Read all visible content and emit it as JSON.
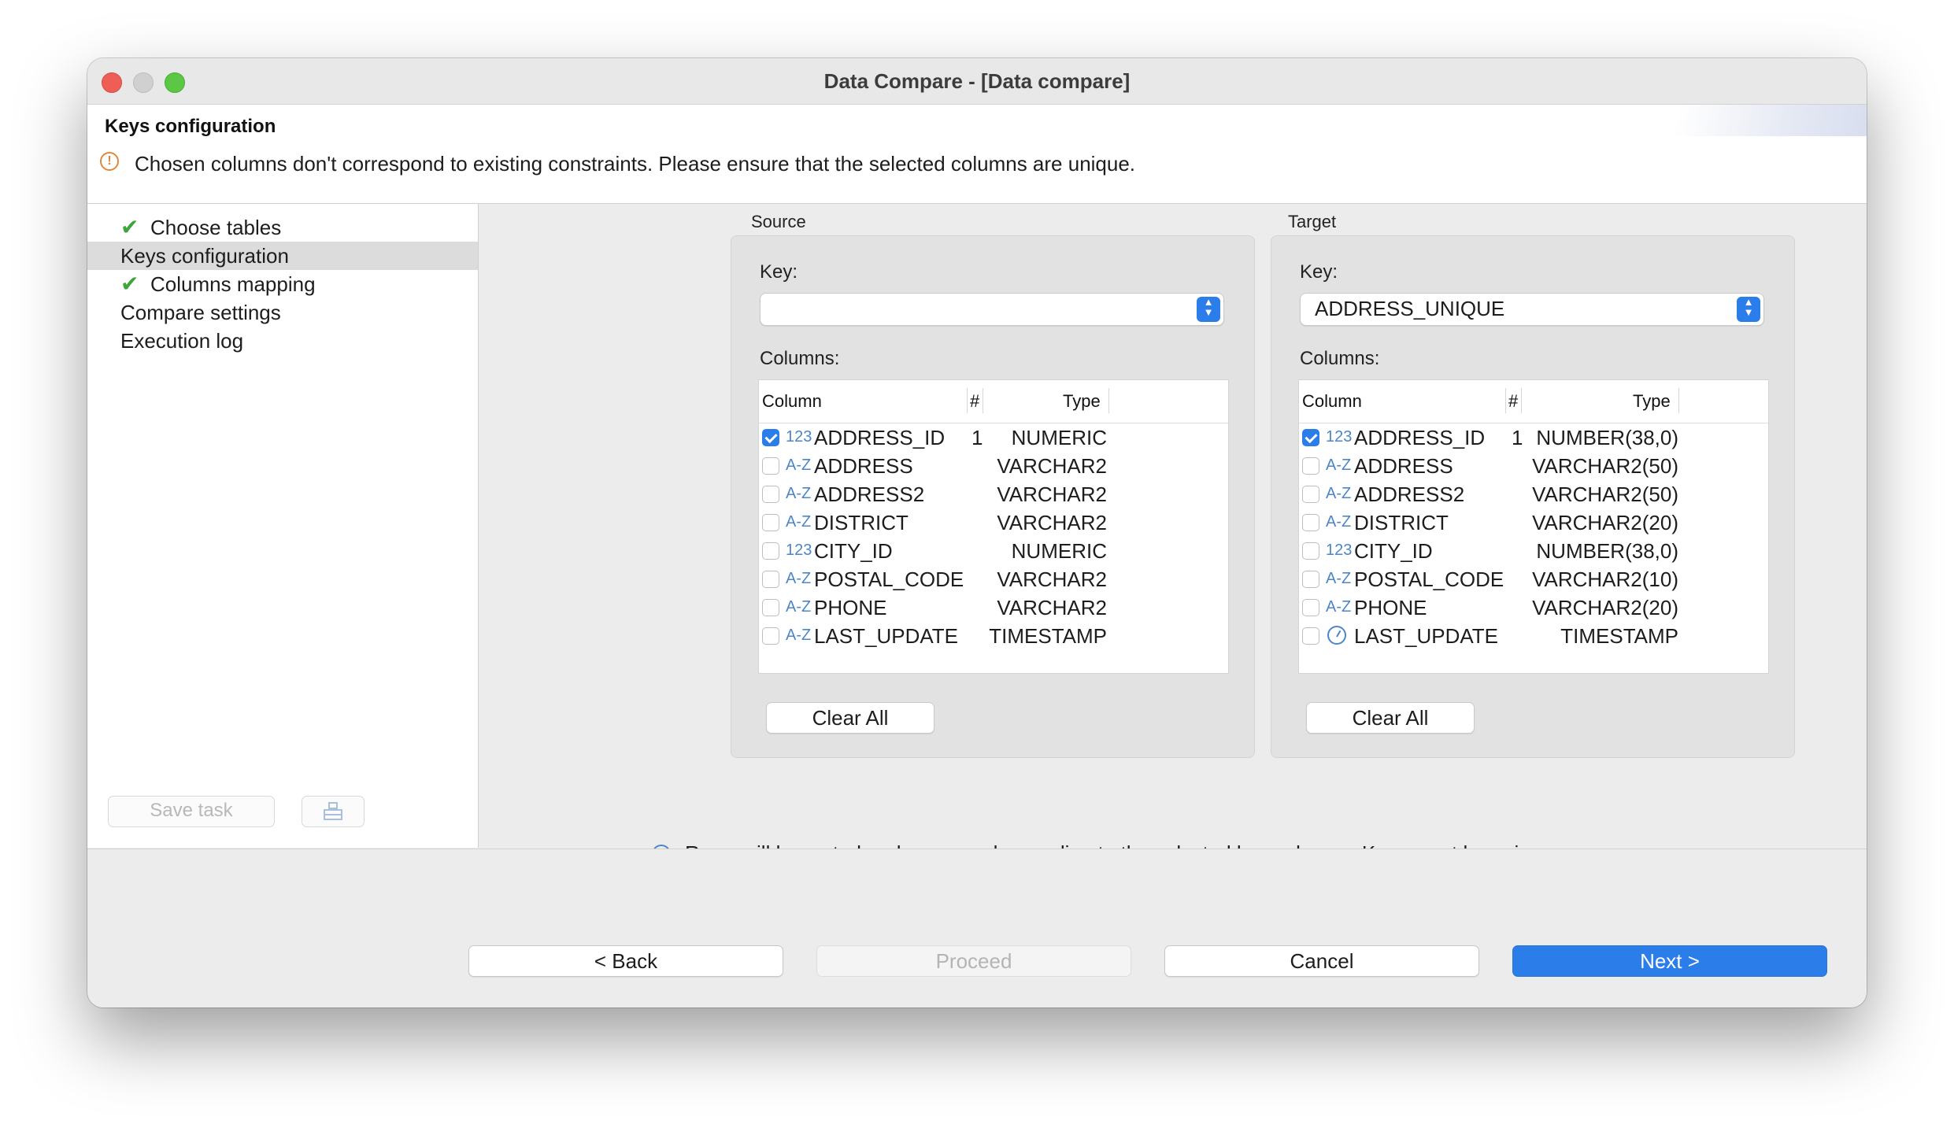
{
  "window": {
    "title": "Data Compare - [Data compare]"
  },
  "header": {
    "heading": "Keys configuration",
    "warning": "Chosen columns don't correspond to existing constraints. Please ensure that the selected columns are unique."
  },
  "sidebar": {
    "items": [
      {
        "label": "Choose tables",
        "done": true,
        "selected": false
      },
      {
        "label": "Keys configuration",
        "done": false,
        "selected": true
      },
      {
        "label": "Columns mapping",
        "done": true,
        "selected": false
      },
      {
        "label": "Compare settings",
        "done": false,
        "selected": false
      },
      {
        "label": "Execution log",
        "done": false,
        "selected": false
      }
    ],
    "save_task_label": "Save task"
  },
  "source": {
    "caption": "Source",
    "key_label": "Key:",
    "key_value": "",
    "columns_label": "Columns:",
    "headers": {
      "column": "Column",
      "num": "#",
      "type": "Type"
    },
    "rows": [
      {
        "checked": true,
        "icon": "123",
        "name": "ADDRESS_ID",
        "num": "1",
        "type": "NUMERIC"
      },
      {
        "checked": false,
        "icon": "A-Z",
        "name": "ADDRESS",
        "num": "",
        "type": "VARCHAR2"
      },
      {
        "checked": false,
        "icon": "A-Z",
        "name": "ADDRESS2",
        "num": "",
        "type": "VARCHAR2"
      },
      {
        "checked": false,
        "icon": "A-Z",
        "name": "DISTRICT",
        "num": "",
        "type": "VARCHAR2"
      },
      {
        "checked": false,
        "icon": "123",
        "name": "CITY_ID",
        "num": "",
        "type": "NUMERIC"
      },
      {
        "checked": false,
        "icon": "A-Z",
        "name": "POSTAL_CODE",
        "num": "",
        "type": "VARCHAR2"
      },
      {
        "checked": false,
        "icon": "A-Z",
        "name": "PHONE",
        "num": "",
        "type": "VARCHAR2"
      },
      {
        "checked": false,
        "icon": "A-Z",
        "name": "LAST_UPDATE",
        "num": "",
        "type": "TIMESTAMP"
      }
    ],
    "clear_all_label": "Clear All"
  },
  "target": {
    "caption": "Target",
    "key_label": "Key:",
    "key_value": "ADDRESS_UNIQUE",
    "columns_label": "Columns:",
    "headers": {
      "column": "Column",
      "num": "#",
      "type": "Type"
    },
    "rows": [
      {
        "checked": true,
        "icon": "123",
        "name": "ADDRESS_ID",
        "num": "1",
        "type": "NUMBER(38,0)"
      },
      {
        "checked": false,
        "icon": "A-Z",
        "name": "ADDRESS",
        "num": "",
        "type": "VARCHAR2(50)"
      },
      {
        "checked": false,
        "icon": "A-Z",
        "name": "ADDRESS2",
        "num": "",
        "type": "VARCHAR2(50)"
      },
      {
        "checked": false,
        "icon": "A-Z",
        "name": "DISTRICT",
        "num": "",
        "type": "VARCHAR2(20)"
      },
      {
        "checked": false,
        "icon": "123",
        "name": "CITY_ID",
        "num": "",
        "type": "NUMBER(38,0)"
      },
      {
        "checked": false,
        "icon": "A-Z",
        "name": "POSTAL_CODE",
        "num": "",
        "type": "VARCHAR2(10)"
      },
      {
        "checked": false,
        "icon": "A-Z",
        "name": "PHONE",
        "num": "",
        "type": "VARCHAR2(20)"
      },
      {
        "checked": false,
        "icon": "clock",
        "name": "LAST_UPDATE",
        "num": "",
        "type": "TIMESTAMP"
      }
    ],
    "clear_all_label": "Clear All"
  },
  "info_text": "Rows will be sorted and compared according to the selected key columns. Keys must be unique.",
  "footer": {
    "back_label": "< Back",
    "proceed_label": "Proceed",
    "cancel_label": "Cancel",
    "next_label": "Next >"
  },
  "colors": {
    "accent": "#2b7de9",
    "check_green": "#3ea53a",
    "warning": "#e0883a",
    "type_icon": "#4b86c8"
  }
}
